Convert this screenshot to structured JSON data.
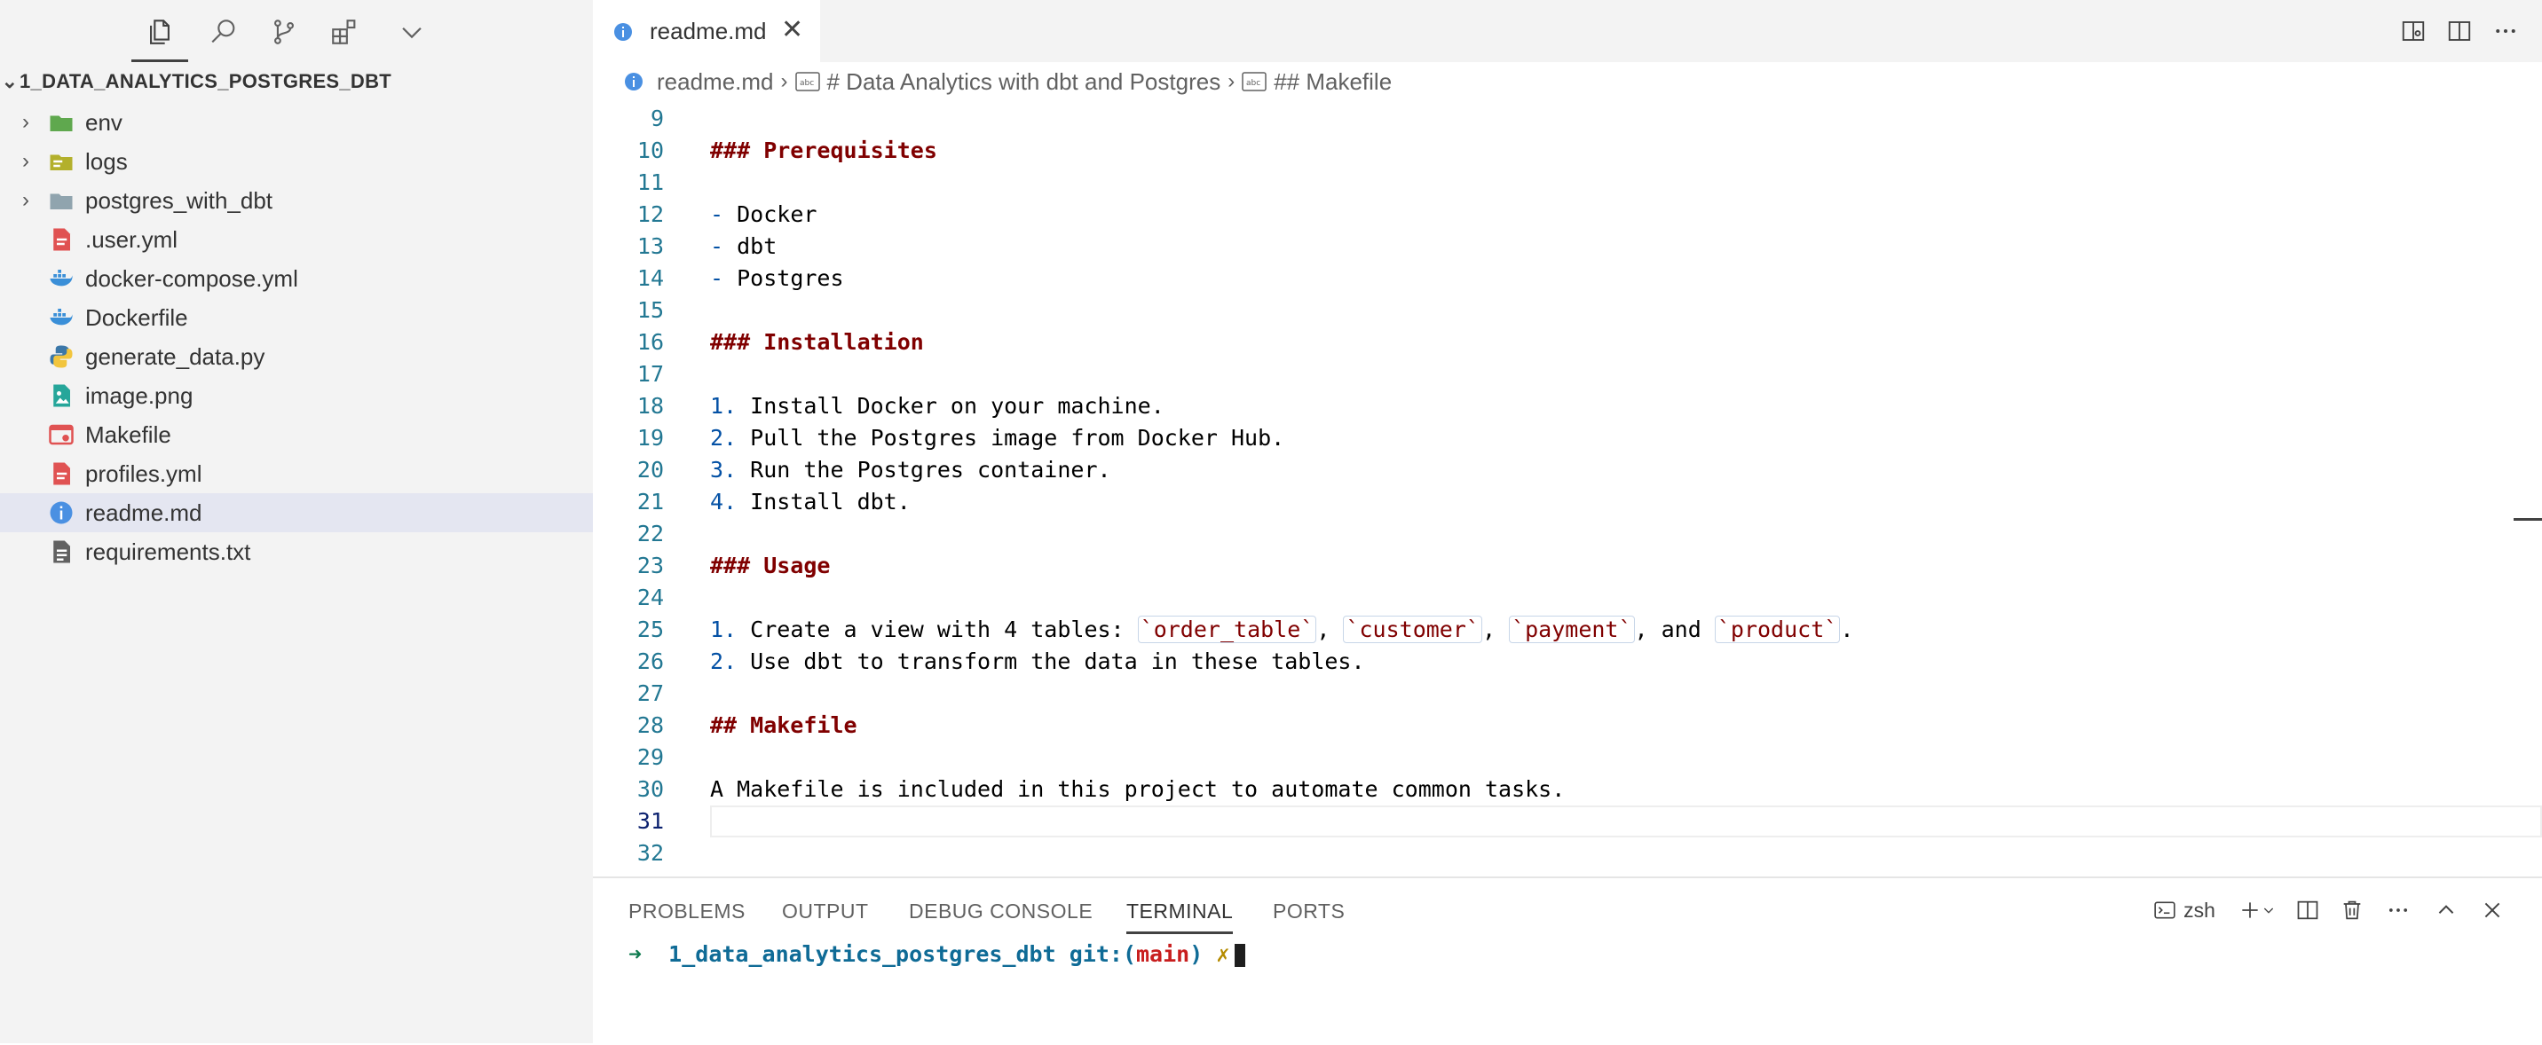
{
  "explorer": {
    "title": "1_DATA_ANALYTICS_POSTGRES_DBT",
    "items": [
      {
        "label": "env",
        "kind": "folder",
        "icon": "folder-env-icon"
      },
      {
        "label": "logs",
        "kind": "folder",
        "icon": "folder-logs-icon"
      },
      {
        "label": "postgres_with_dbt",
        "kind": "folder",
        "icon": "folder-icon"
      },
      {
        "label": ".user.yml",
        "kind": "file",
        "icon": "yaml-file-icon"
      },
      {
        "label": "docker-compose.yml",
        "kind": "file",
        "icon": "docker-icon"
      },
      {
        "label": "Dockerfile",
        "kind": "file",
        "icon": "docker-icon"
      },
      {
        "label": "generate_data.py",
        "kind": "file",
        "icon": "python-icon"
      },
      {
        "label": "image.png",
        "kind": "file",
        "icon": "image-file-icon"
      },
      {
        "label": "Makefile",
        "kind": "file",
        "icon": "makefile-icon"
      },
      {
        "label": "profiles.yml",
        "kind": "file",
        "icon": "yaml-file-icon"
      },
      {
        "label": "readme.md",
        "kind": "file",
        "icon": "info-icon"
      },
      {
        "label": "requirements.txt",
        "kind": "file",
        "icon": "text-file-icon"
      }
    ]
  },
  "tab": {
    "name": "readme.md",
    "close": "✕"
  },
  "breadcrumb": {
    "file": "readme.md",
    "section": "# Data Analytics with dbt and Postgres",
    "subsection": "## Makefile",
    "sep": "›"
  },
  "editor": {
    "lines": [
      {
        "n": "9",
        "text": ""
      },
      {
        "n": "10",
        "text": "### Prerequisites"
      },
      {
        "n": "11",
        "text": ""
      },
      {
        "n": "12",
        "text": "- Docker"
      },
      {
        "n": "13",
        "text": "- dbt"
      },
      {
        "n": "14",
        "text": "- Postgres"
      },
      {
        "n": "15",
        "text": ""
      },
      {
        "n": "16",
        "text": "### Installation"
      },
      {
        "n": "17",
        "text": ""
      },
      {
        "n": "18",
        "text": "1. Install Docker on your machine."
      },
      {
        "n": "19",
        "text": "2. Pull the Postgres image from Docker Hub."
      },
      {
        "n": "20",
        "text": "3. Run the Postgres container."
      },
      {
        "n": "21",
        "text": "4. Install dbt."
      },
      {
        "n": "22",
        "text": ""
      },
      {
        "n": "23",
        "text": "### Usage"
      },
      {
        "n": "24",
        "text": ""
      },
      {
        "n": "25",
        "text": "1. Create a view with 4 tables: `order_table`, `customer`, `payment`, and `product`."
      },
      {
        "n": "26",
        "text": "2. Use dbt to transform the data in these tables."
      },
      {
        "n": "27",
        "text": ""
      },
      {
        "n": "28",
        "text": "## Makefile"
      },
      {
        "n": "29",
        "text": ""
      },
      {
        "n": "30",
        "text": "A Makefile is included in this project to automate common tasks."
      },
      {
        "n": "31",
        "text": ""
      },
      {
        "n": "32",
        "text": ""
      }
    ],
    "current_line": "31"
  },
  "panel": {
    "tabs": [
      "PROBLEMS",
      "OUTPUT",
      "DEBUG CONSOLE",
      "TERMINAL",
      "PORTS"
    ],
    "active_tab": "TERMINAL",
    "shell": "zsh",
    "terminal": {
      "arrow": "➜",
      "dir": "1_data_analytics_postgres_dbt",
      "git": "git:(",
      "branch": "main",
      "git_close": ")",
      "dirty": "✗"
    }
  },
  "colors": {
    "sidebar_bg": "#f3f3f3",
    "selected_bg": "#e4e6f1",
    "heading": "#800000",
    "line_number": "#237893",
    "list_marker": "#0451a5"
  }
}
